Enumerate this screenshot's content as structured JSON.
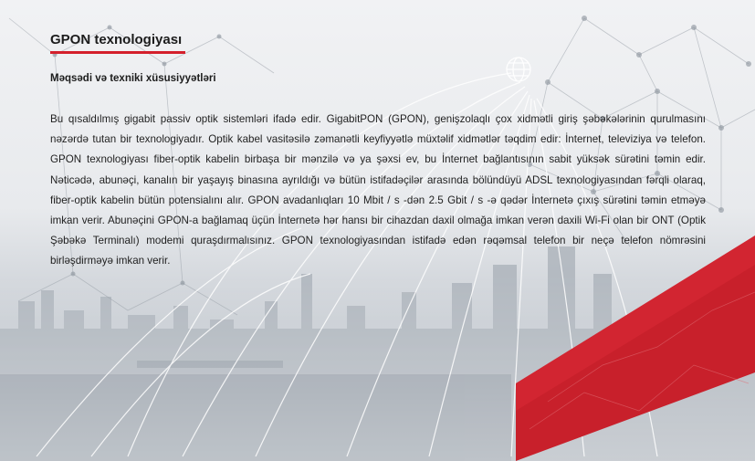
{
  "page": {
    "title": "GPON texnologiyası",
    "subtitle": "Məqsədi və texniki xüsusiyyətləri",
    "body": "Bu qısaldılmış gigabit passiv optik sistemləri ifadə edir. GigabitPON (GPON), genişzolaqlı çox xidmətli giriş şəbəkələrinin qurulmasını nəzərdə tutan bir texnologiyadır. Optik kabel vasitəsilə zəmanətli keyfiyyətlə müxtəlif xidmətlər təqdim edir: İnternet, televiziya və telefon. GPON texnologiyası fiber-optik kabelin birbaşa bir mənzilə və ya şəxsi ev, bu İnternet bağlantısının sabit yüksək sürətini təmin edir. Nəticədə, abunəçi, kanalın bir yaşayış binasına ayrıldığı və bütün istifadəçilər arasında bölündüyü ADSL texnologiyasından fərqli olaraq, fiber-optik kabelin bütün potensialını alır. GPON avadanlıqları 10 Mbit / s -dən 2.5 Gbit / s -ə qədər İnternetə çıxış sürətini təmin etməyə imkan verir. Abunəçini GPON-a bağlamaq üçün İnter­netə hər hansı bir cihazdan daxil olmağa imkan verən daxili Wi-Fi olan bir ONT (Optik Şəbəkə Terminalı) modemi quraşdır­malısınız. GPON texnologiyasından istifadə edən rəqəmsal telefon bir neçə telefon nömrəsini birləşdirməyə imkan verir."
  },
  "colors": {
    "accent": "#d4202c",
    "text": "#1f1f1f"
  },
  "icons": {
    "globe": "globe-icon"
  }
}
